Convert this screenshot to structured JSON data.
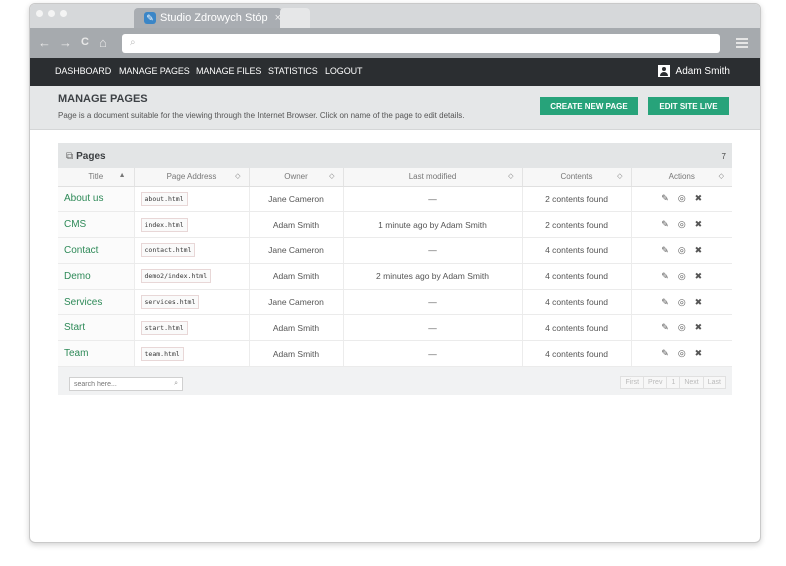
{
  "browser": {
    "tab_title": "Studio Zdrowych Stóp",
    "tab_close": "×",
    "tab_icon": "feather-icon",
    "nav": {
      "back": "←",
      "forward": "→",
      "reload": "C",
      "home": "⌂"
    },
    "url_search_glyph": "⌕",
    "url": ""
  },
  "menu": {
    "items": [
      "DASHBOARD",
      "MANAGE PAGES",
      "MANAGE FILES",
      "STATISTICS",
      "LOGOUT"
    ],
    "user_name": "Adam Smith"
  },
  "header": {
    "title": "MANAGE PAGES",
    "description": "Page is a document suitable for the viewing through the Internet Browser. Click on name of the page to edit details.",
    "create_button": "CREATE NEW PAGE",
    "live_button": "EDIT SITE LIVE",
    "accent_color": "#27a37a"
  },
  "panel": {
    "title": "Pages",
    "count": "7",
    "columns": [
      "Title",
      "Page Address",
      "Owner",
      "Last modified",
      "Contents",
      "Actions"
    ],
    "rows": [
      {
        "title": "About us",
        "address": "about.html",
        "owner": "Jane Cameron",
        "modified": "—",
        "contents": "2 contents found"
      },
      {
        "title": "CMS",
        "address": "index.html",
        "owner": "Adam Smith",
        "modified": "1 minute ago by Adam Smith",
        "contents": "2 contents found"
      },
      {
        "title": "Contact",
        "address": "contact.html",
        "owner": "Jane Cameron",
        "modified": "—",
        "contents": "4 contents found"
      },
      {
        "title": "Demo",
        "address": "demo2/index.html",
        "owner": "Adam Smith",
        "modified": "2 minutes ago by Adam Smith",
        "contents": "4 contents found"
      },
      {
        "title": "Services",
        "address": "services.html",
        "owner": "Jane Cameron",
        "modified": "—",
        "contents": "4 contents found"
      },
      {
        "title": "Start",
        "address": "start.html",
        "owner": "Adam Smith",
        "modified": "—",
        "contents": "4 contents found"
      },
      {
        "title": "Team",
        "address": "team.html",
        "owner": "Adam Smith",
        "modified": "—",
        "contents": "4 contents found"
      }
    ],
    "search_placeholder": "search here...",
    "pager": [
      "First",
      "Prev",
      "1",
      "Next",
      "Last"
    ]
  }
}
